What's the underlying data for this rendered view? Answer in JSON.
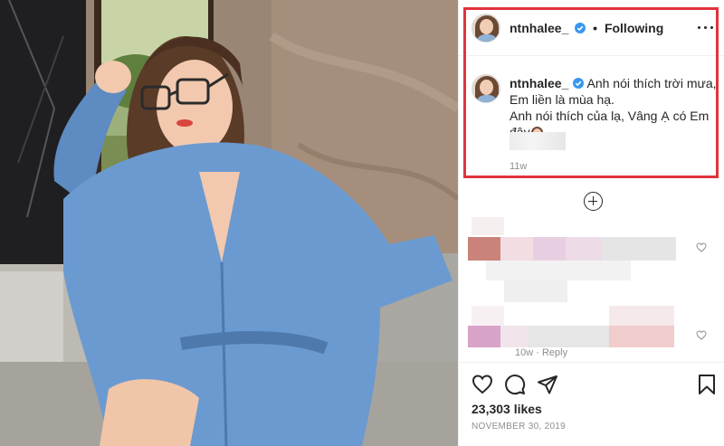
{
  "post": {
    "author": "ntnhalee_",
    "follow_status": "Following",
    "caption_lines": [
      "Anh nói thích trời mưa,",
      "Em liền là mùa hạ.",
      "Anh nói thích của lạ, Vâng Ạ có Em",
      "đây"
    ],
    "caption_time": "11w",
    "likes": "23,303 likes",
    "date": "NOVEMBER 30, 2019",
    "comment_reply": "10w · Reply"
  },
  "icons": {
    "verified": "verified-badge-icon",
    "more": "more-options-icon",
    "load_more": "load-more-comments-icon",
    "like": "heart-icon",
    "comment": "comment-icon",
    "share": "share-icon",
    "save": "bookmark-icon"
  },
  "colors": {
    "highlight_border": "#e0343c",
    "verified_blue": "#3897f0",
    "muted_text": "#8e8e8e"
  }
}
